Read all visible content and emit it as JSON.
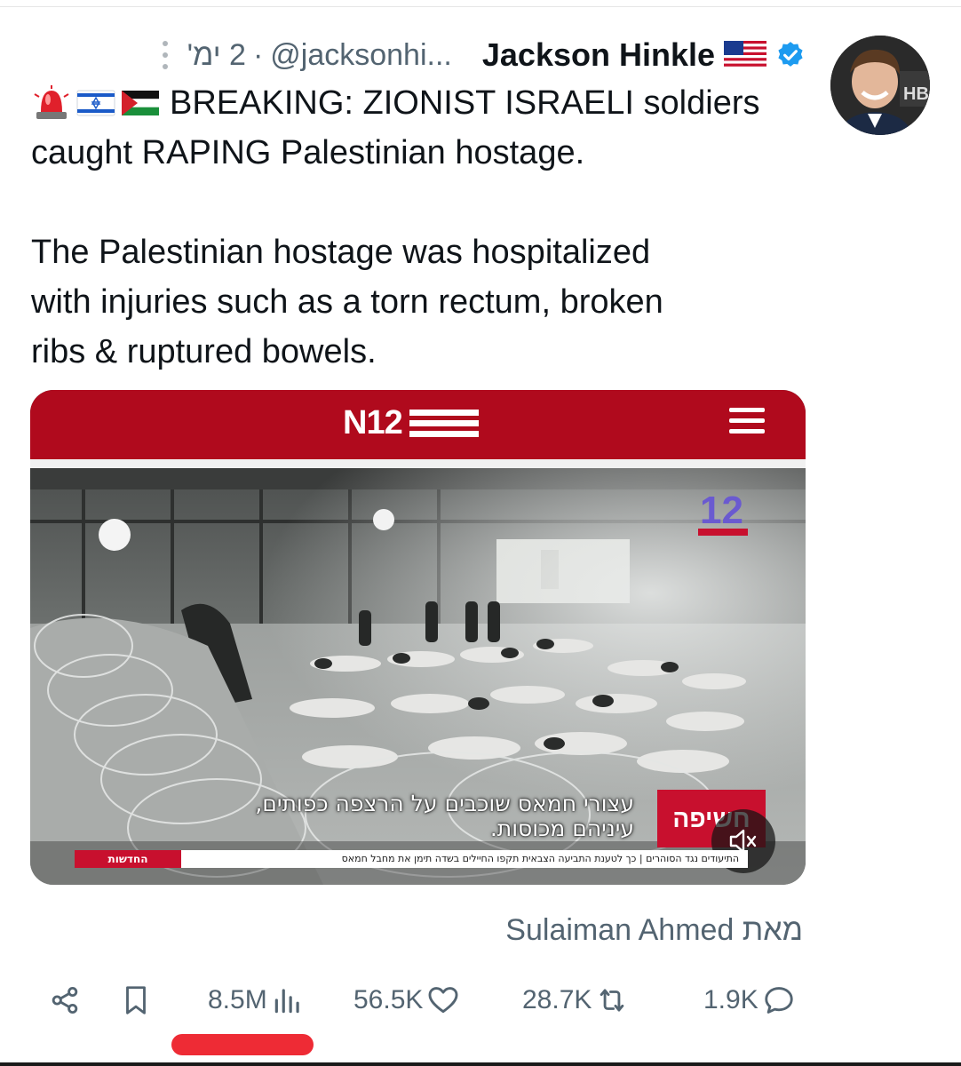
{
  "tweet": {
    "author_name": "Jackson Hinkle",
    "handle": "@jacksonhi...",
    "separator": "·",
    "time": "2 ימ'",
    "avatar_badge": "HB",
    "text_line1": "BREAKING: ZIONIST ISRAELI soldiers",
    "text_line2": "caught RAPING Palestinian hostage.",
    "text_line3": "The Palestinian hostage was hospitalized",
    "text_line4": "with injuries such as a torn rectum, broken",
    "text_line5": "ribs & ruptured bowels.",
    "emojis": [
      "police-light-emoji",
      "israel-flag-emoji",
      "palestine-flag-emoji"
    ],
    "credit": "מאת Sulaiman Ahmed"
  },
  "media": {
    "site_logo": "N12",
    "channel_logo": "12",
    "channel_logo_sub": "החדשות",
    "badge": "חשיפה",
    "caption_line1": "עצורי חמאס שוכבים על הרצפה כפותים,",
    "caption_line2": "עיניהם מכוסות.",
    "ticker": "התיעודים נגד הסוהרים | כך לטענת התביעה הצבאית תקפו החיילים בשדה תימן את מחבל חמאס",
    "ticker_logo": "החדשות"
  },
  "actions": {
    "views": "8.5M",
    "likes": "56.5K",
    "retweets": "28.7K",
    "replies": "1.9K"
  },
  "colors": {
    "accent_red": "#b00a1d",
    "verified_blue": "#1d9bf0",
    "muted_text": "#536471",
    "highlight_underline": "#ee2b35"
  }
}
